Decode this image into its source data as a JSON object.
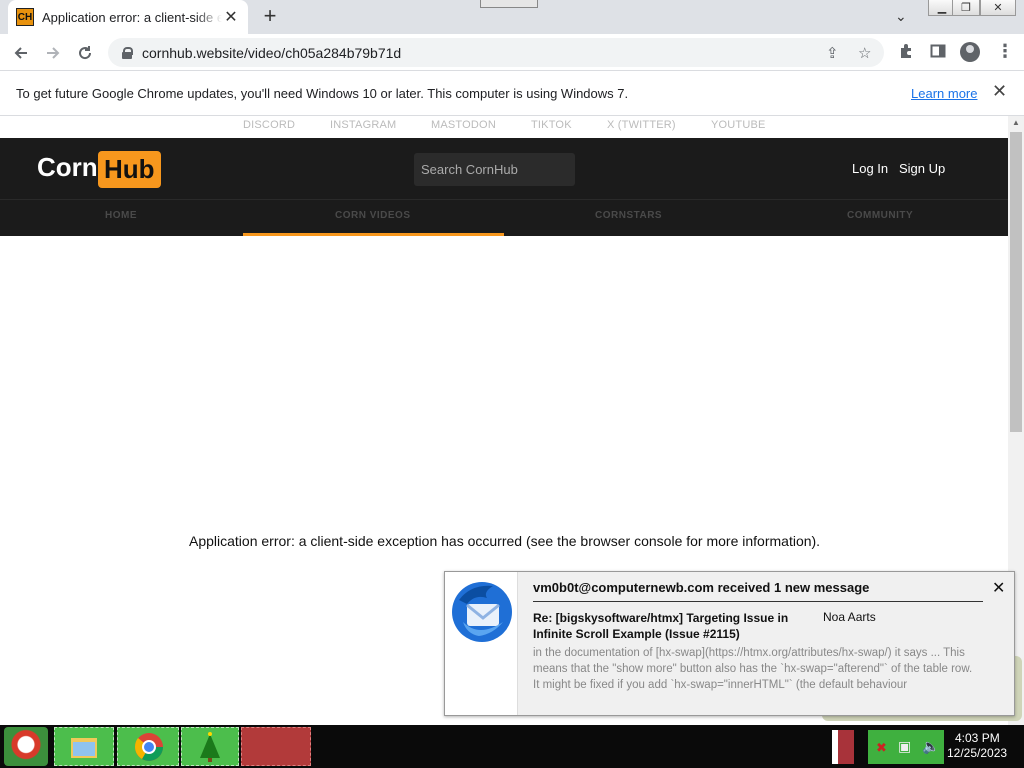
{
  "browser": {
    "tab_title": "Application error: a client-side exception has occurred",
    "tab_favicon_text": "CH",
    "url": "cornhub.website/video/ch05a284b79b71d",
    "icons": {
      "back": "arrow-left-icon",
      "forward": "arrow-right-icon",
      "reload": "reload-icon",
      "share": "share-icon",
      "bookmark": "star-icon",
      "extensions": "puzzle-icon",
      "side_panel": "side-panel-icon",
      "profile": "profile-icon",
      "menu": "menu-dots-icon"
    }
  },
  "infobar": {
    "message": "To get future Google Chrome updates, you'll need Windows 10 or later. This computer is using Windows 7.",
    "link": "Learn more"
  },
  "site": {
    "social_links": [
      "DISCORD",
      "INSTAGRAM",
      "MASTODON",
      "TIKTOK",
      "X (TWITTER)",
      "YOUTUBE"
    ],
    "logo_left": "Corn",
    "logo_right": "Hub",
    "search_placeholder": "Search CornHub",
    "login": "Log In",
    "signup": "Sign Up",
    "nav": [
      "HOME",
      "CORN VIDEOS",
      "CORNSTARS",
      "COMMUNITY"
    ],
    "active_nav": "CORN VIDEOS",
    "accent": "#f7971d",
    "error_message": "Application error: a client-side exception has occurred (see the browser console for more information)."
  },
  "notification": {
    "from": "vm0b0t@computernewb.com received 1 new message",
    "subject": "Re: [bigskysoftware/htmx] Targeting Issue in Infinite Scroll Example (Issue #2115)",
    "sender": "Noa Aarts",
    "body": "in the documentation of [hx-swap](https://htmx.org/attributes/hx-swap/) it says ... This means that the \"show more\" button also has the `hx-swap=\"afterend\"` of the table row. It might be fixed if you add `hx-swap=\"innerHTML\"` (the default behaviour"
  },
  "taskbar": {
    "time": "4:03 PM",
    "date": "12/25/2023"
  }
}
